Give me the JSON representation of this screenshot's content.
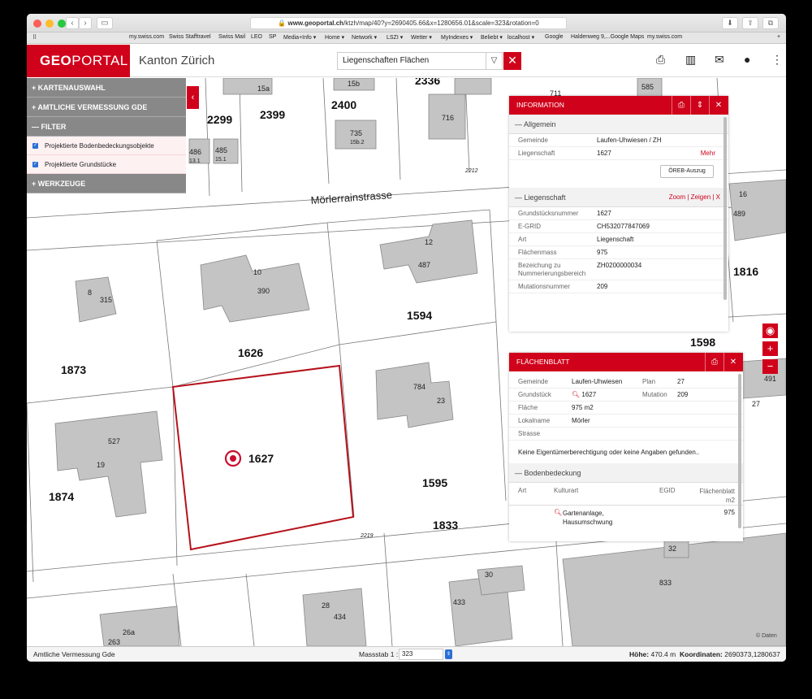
{
  "browser": {
    "url_domain": "www.geoportal.ch",
    "url_path": "/ktzh/map/40?y=2690405.66&x=1280656.01&scale=323&rotation=0",
    "bookmarks": [
      "my.swiss.com",
      "Swiss Stafftravel",
      "Swiss Mail",
      "LEO",
      "SP",
      "Media+Info ▾",
      "Home ▾",
      "Network ▾",
      "LSZI ▾",
      "Wetter ▾",
      "MyIndexes ▾",
      "Beliebt ▾",
      "localhost ▾",
      "Google",
      "Haldenweg 9,...Google Maps",
      "my.swiss.com"
    ]
  },
  "header": {
    "logo_bold": "GEO",
    "logo_rest": "PORTAL",
    "kanton": "Kanton Zürich",
    "search_value": "Liegenschaften Flächen",
    "icons": [
      "print-icon",
      "map-icon",
      "mail-icon",
      "user-icon",
      "more-icon"
    ]
  },
  "left_panel": {
    "sections": [
      {
        "label": "+ KARTENAUSWAHL"
      },
      {
        "label": "+ AMTLICHE VERMESSUNG GDE"
      },
      {
        "label": "— FILTER"
      }
    ],
    "filter_items": [
      "Projektierte Bodenbedeckungsobjekte",
      "Projektierte Grundstücke"
    ],
    "werkzeuge": "+ WERKZEUGE"
  },
  "map": {
    "street_name": "Mörlerrainstrasse",
    "parcels": [
      "2299",
      "2399",
      "2400",
      "2336",
      "1626",
      "1594",
      "1873",
      "1874",
      "1627",
      "1595",
      "1833",
      "1816",
      "1598"
    ],
    "buildings": [
      "15a",
      "15b",
      "716",
      "735",
      "15b.2",
      "486",
      "13.1",
      "485",
      "15.1",
      "10",
      "390",
      "12",
      "487",
      "8",
      "315",
      "784",
      "23",
      "527",
      "19",
      "30",
      "433",
      "28",
      "434",
      "26a",
      "263",
      "585",
      "711",
      "16",
      "489",
      "491",
      "27",
      "32",
      "833"
    ],
    "labels_small": [
      "2212",
      "2219"
    ],
    "copyright": "© Daten"
  },
  "information": {
    "title": "INFORMATION",
    "allgemein": {
      "title": "— Allgemein",
      "gemeinde_label": "Gemeinde",
      "gemeinde": "Laufen-Uhwiesen / ZH",
      "liegenschaft_label": "Liegenschaft",
      "liegenschaft": "1627",
      "mehr": "Mehr",
      "oereb_button": "ÖREB-Auszug"
    },
    "liegenschaft": {
      "title": "— Liegenschaft",
      "links": "Zoom | Zeigen | X",
      "rows": [
        {
          "k": "Grundstücksnummer",
          "v": "1627"
        },
        {
          "k": "E-GRID",
          "v": "CH532077847069"
        },
        {
          "k": "Art",
          "v": "Liegenschaft"
        },
        {
          "k": "Flächenmass",
          "v": "975"
        },
        {
          "k": "Bezeichung zu Nummerierungsbereich",
          "v": "ZH0200000034"
        },
        {
          "k": "Mutationsnummer",
          "v": "209"
        }
      ]
    }
  },
  "flaechenblatt": {
    "title": "FLÄCHENBLATT",
    "gemeinde_label": "Gemeinde",
    "gemeinde": "Laufen-Uhwiesen",
    "plan_label": "Plan",
    "plan": "27",
    "grundstueck_label": "Grundstück",
    "grundstueck": "1627",
    "mutation_label": "Mutation",
    "mutation": "209",
    "flaeche_label": "Fläche",
    "flaeche": "975 m2",
    "lokalname_label": "Lokalname",
    "lokalname": "Mörler",
    "strasse_label": "Strasse",
    "strasse": "",
    "note": "Keine Eigentümerberechtigung oder keine Angaben gefunden..",
    "bodenbedeckung_title": "— Bodenbedeckung",
    "columns": [
      "Art",
      "Kulturart",
      "EGID",
      "Flächenblatt m2"
    ],
    "rows": [
      {
        "art": "",
        "kulturart": "Gartenanlage, Hausumschwung",
        "egid": "",
        "flaeche": "975"
      }
    ]
  },
  "status": {
    "left": "Amtliche Vermessung Gde",
    "massstab_label": "Massstab 1 :",
    "massstab_value": "323",
    "hoehe_label": "Höhe:",
    "hoehe_value": "470.4 m",
    "koord_label": "Koordinaten:",
    "koord_value": "2690373,1280637"
  }
}
